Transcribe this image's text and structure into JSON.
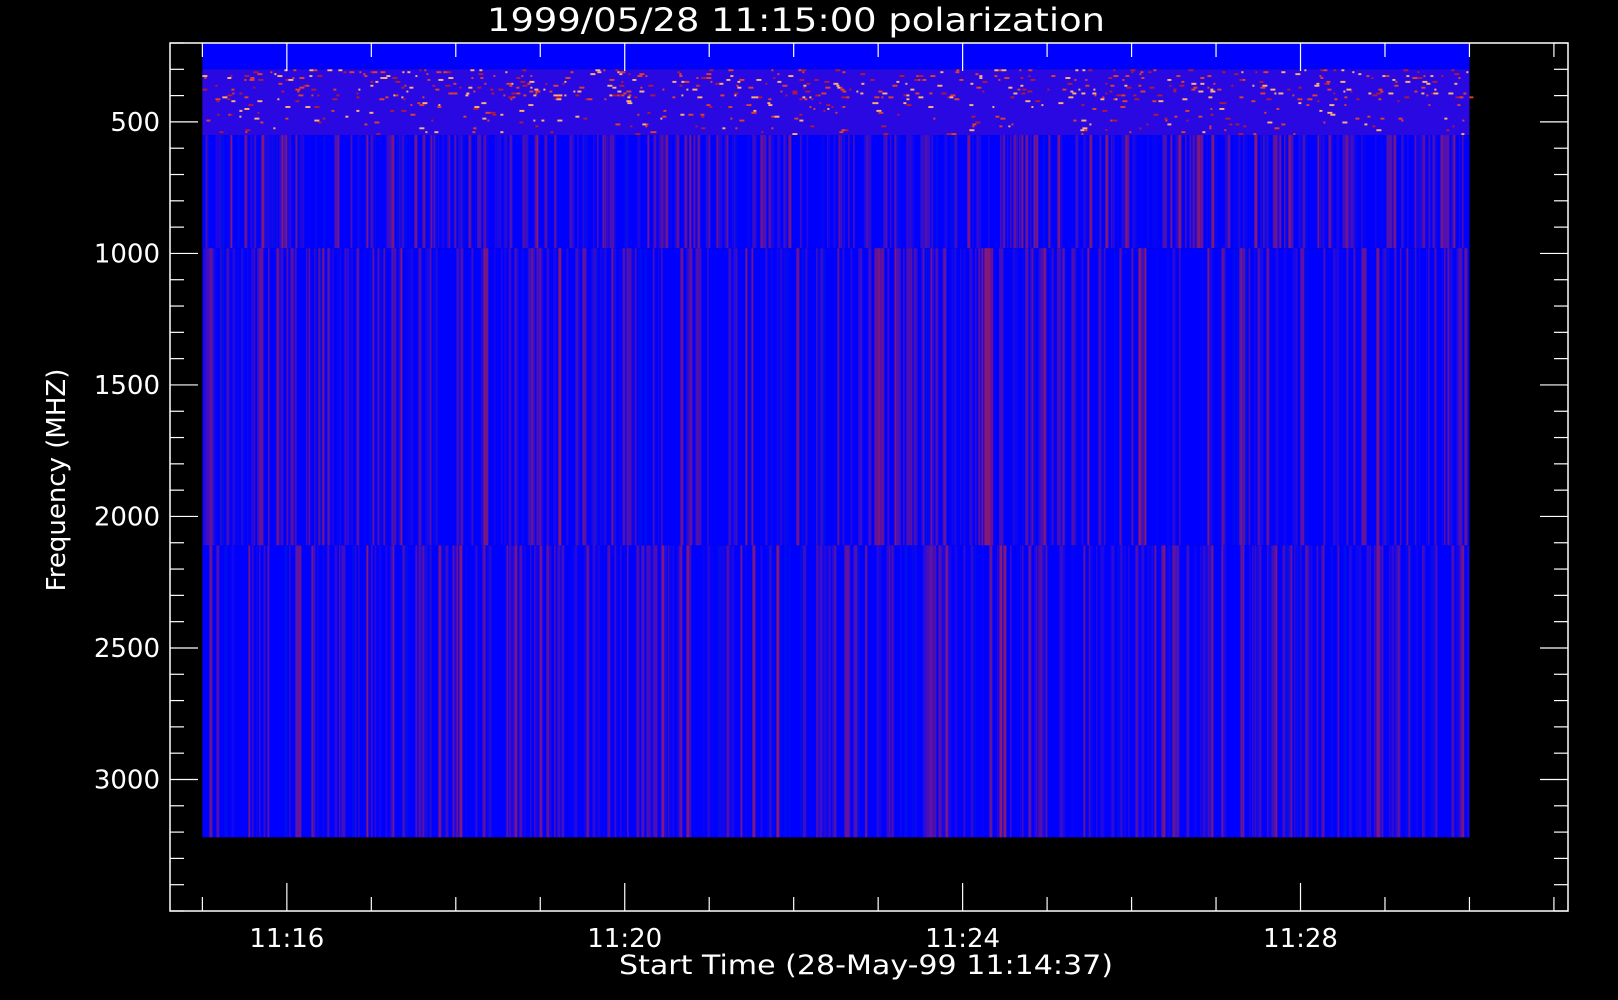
{
  "chart_data": {
    "type": "heatmap",
    "title": "1999/05/28 11:15:00 polarization",
    "xlabel": "Start Time (28-May-99 11:14:37)",
    "ylabel": "Frequency (MHZ)",
    "x_axis": {
      "unit": "time",
      "range": [
        "11:14:37",
        "11:31:10"
      ],
      "data_range": [
        "11:15:00",
        "11:30:00"
      ],
      "ticks": [
        "11:16",
        "11:20",
        "11:24",
        "11:28"
      ],
      "minor_ticks_per_major": 4
    },
    "y_axis": {
      "unit": "MHz",
      "range": [
        200,
        3500
      ],
      "inverted": true,
      "data_range": [
        200,
        3220
      ],
      "ticks": [
        500,
        1000,
        1500,
        2000,
        2500,
        3000
      ],
      "tick_labels": [
        "500",
        "1000",
        "1500",
        "2000",
        "2500",
        "3000"
      ],
      "minor_step": 100
    },
    "bands": [
      {
        "range_mhz": [
          200,
          300
        ],
        "pattern": "uniform"
      },
      {
        "range_mhz": [
          300,
          550
        ],
        "pattern": "speckled"
      },
      {
        "range_mhz": [
          550,
          980
        ],
        "pattern": "striped"
      },
      {
        "range_mhz": [
          980,
          2110
        ],
        "pattern": "striped"
      },
      {
        "range_mhz": [
          2110,
          3220
        ],
        "pattern": "striped"
      }
    ],
    "colors": {
      "background": "#000000",
      "axes": "#ffffff",
      "base": "#0000ff",
      "mid": "#4a0fc8",
      "high": "#b01a3a",
      "speckle_hot": "#ffb070",
      "speckle_warm": "#e0402a"
    },
    "grid": false,
    "legend": "none"
  }
}
